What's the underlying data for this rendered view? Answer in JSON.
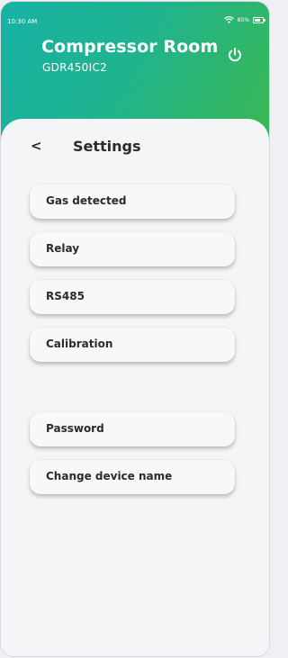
{
  "status_bar": {
    "time": "10:30 AM",
    "battery": "85%"
  },
  "header": {
    "title": "Compressor Room",
    "model": "GDR450IC2",
    "power_icon": "power-icon"
  },
  "settings": {
    "back_label": "<",
    "title": "Settings",
    "items": [
      {
        "label": "Gas detected"
      },
      {
        "label": "Relay"
      },
      {
        "label": "RS485"
      },
      {
        "label": "Calibration"
      },
      {
        "label": "Password"
      },
      {
        "label": "Change device name"
      }
    ]
  },
  "colors": {
    "gradient_start": "#17b2a4",
    "gradient_end": "#3bb84f",
    "panel_bg": "#f4f5f7",
    "text": "#2a2a2a"
  }
}
